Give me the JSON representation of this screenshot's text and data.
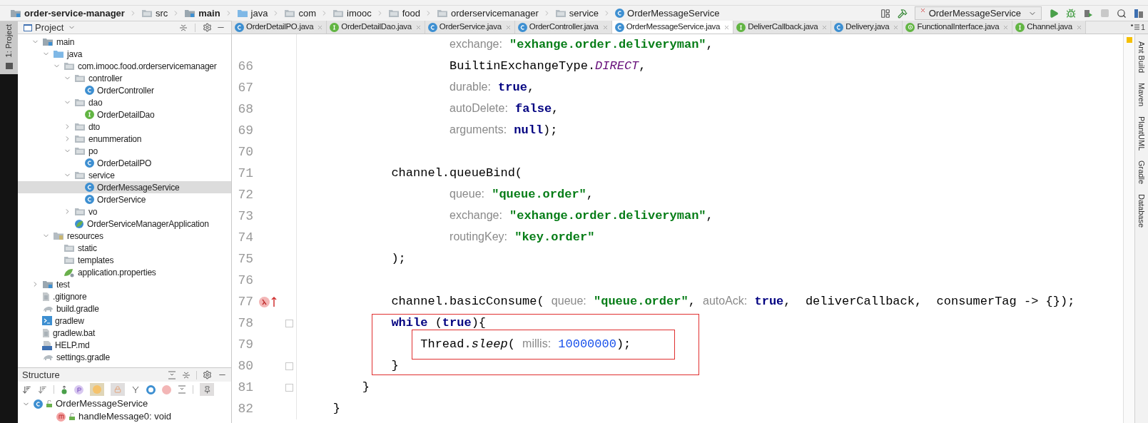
{
  "breadcrumbs": [
    {
      "label": "order-service-manager",
      "kind": "module",
      "bold": true
    },
    {
      "label": "src",
      "kind": "folder",
      "bold": false
    },
    {
      "label": "main",
      "kind": "module",
      "bold": true
    },
    {
      "label": "java",
      "kind": "source",
      "bold": false
    },
    {
      "label": "com",
      "kind": "folder",
      "bold": false
    },
    {
      "label": "imooc",
      "kind": "folder",
      "bold": false
    },
    {
      "label": "food",
      "kind": "folder",
      "bold": false
    },
    {
      "label": "orderservicemanager",
      "kind": "folder",
      "bold": false
    },
    {
      "label": "service",
      "kind": "folder",
      "bold": false
    },
    {
      "label": "OrderMessageService",
      "kind": "class",
      "bold": false
    }
  ],
  "run_config": {
    "label": "OrderMessageService"
  },
  "left_strip": {
    "label": "1: Project"
  },
  "project_panel": {
    "title": "Project",
    "tree": [
      {
        "label": "main",
        "kind": "module",
        "expanded": true,
        "selected": false,
        "children": [
          {
            "label": "java",
            "kind": "source",
            "expanded": true,
            "selected": false,
            "children": [
              {
                "label": "com.imooc.food.orderservicemanager",
                "kind": "folder",
                "expanded": true,
                "selected": false,
                "children": [
                  {
                    "label": "controller",
                    "kind": "folder",
                    "expanded": true,
                    "selected": false,
                    "children": [
                      {
                        "label": "OrderController",
                        "kind": "class",
                        "selected": false
                      }
                    ]
                  },
                  {
                    "label": "dao",
                    "kind": "folder",
                    "expanded": true,
                    "selected": false,
                    "children": [
                      {
                        "label": "OrderDetailDao",
                        "kind": "interface",
                        "selected": false
                      }
                    ]
                  },
                  {
                    "label": "dto",
                    "kind": "folder",
                    "expanded": false,
                    "selected": false
                  },
                  {
                    "label": "enummeration",
                    "kind": "folder",
                    "expanded": false,
                    "selected": false
                  },
                  {
                    "label": "po",
                    "kind": "folder",
                    "expanded": true,
                    "selected": false,
                    "children": [
                      {
                        "label": "OrderDetailPO",
                        "kind": "class",
                        "selected": false
                      }
                    ]
                  },
                  {
                    "label": "service",
                    "kind": "folder",
                    "expanded": true,
                    "selected": false,
                    "children": [
                      {
                        "label": "OrderMessageService",
                        "kind": "class",
                        "selected": true
                      },
                      {
                        "label": "OrderService",
                        "kind": "class",
                        "selected": false
                      }
                    ]
                  },
                  {
                    "label": "vo",
                    "kind": "folder",
                    "expanded": false,
                    "selected": false
                  },
                  {
                    "label": "OrderServiceManagerApplication",
                    "kind": "spring",
                    "selected": false
                  }
                ]
              }
            ]
          },
          {
            "label": "resources",
            "kind": "resources",
            "expanded": true,
            "selected": false,
            "children": [
              {
                "label": "static",
                "kind": "folder",
                "selected": false
              },
              {
                "label": "templates",
                "kind": "folder",
                "selected": false
              },
              {
                "label": "application.properties",
                "kind": "properties",
                "selected": false
              }
            ]
          }
        ]
      },
      {
        "label": "test",
        "kind": "module",
        "expanded": false,
        "selected": false
      },
      {
        "label": ".gitignore",
        "kind": "file",
        "selected": false
      },
      {
        "label": "build.gradle",
        "kind": "gradle",
        "selected": false
      },
      {
        "label": "gradlew",
        "kind": "shell",
        "selected": false
      },
      {
        "label": "gradlew.bat",
        "kind": "file",
        "selected": false
      },
      {
        "label": "HELP.md",
        "kind": "markdown",
        "selected": false
      },
      {
        "label": "settings.gradle",
        "kind": "gradle",
        "selected": false
      }
    ]
  },
  "structure_panel": {
    "title": "Structure",
    "tree": [
      {
        "label": "OrderMessageService",
        "kind": "class",
        "expanded": true,
        "children": [
          {
            "label": "handleMessage0: void",
            "kind": "method"
          }
        ]
      }
    ]
  },
  "tabs": [
    {
      "label": "OrderDetailPO.java",
      "kind": "class",
      "selected": false
    },
    {
      "label": "OrderDetailDao.java",
      "kind": "interface",
      "selected": false
    },
    {
      "label": "OrderService.java",
      "kind": "class",
      "selected": false
    },
    {
      "label": "OrderController.java",
      "kind": "class",
      "selected": false
    },
    {
      "label": "OrderMessageService.java",
      "kind": "class",
      "selected": true
    },
    {
      "label": "DeliverCallback.java",
      "kind": "interface",
      "selected": false
    },
    {
      "label": "Delivery.java",
      "kind": "class",
      "selected": false
    },
    {
      "label": "FunctionalInterface.java",
      "kind": "annotation",
      "selected": false
    },
    {
      "label": "Channel.java",
      "kind": "interface",
      "selected": false
    }
  ],
  "tab_overflow": "1",
  "editor": {
    "lines": [
      {
        "fold": false,
        "tokens": [
          {
            "kind": "hint",
            "text": "                    exchange:"
          },
          {
            "kind": "string",
            "text": " \"exhange.order.deliveryman\""
          },
          {
            "kind": "plain",
            "text": ","
          }
        ]
      },
      {
        "num": "66",
        "fold": false,
        "tokens": [
          {
            "kind": "plain",
            "text": "                    BuiltinExchangeType."
          },
          {
            "kind": "constant",
            "text": "DIRECT"
          },
          {
            "kind": "plain",
            "text": ","
          }
        ]
      },
      {
        "num": "67",
        "fold": false,
        "tokens": [
          {
            "kind": "hint",
            "text": "                    durable:"
          },
          {
            "kind": "keyword",
            "text": " true"
          },
          {
            "kind": "plain",
            "text": ","
          }
        ]
      },
      {
        "num": "68",
        "fold": false,
        "tokens": [
          {
            "kind": "hint",
            "text": "                    autoDelete:"
          },
          {
            "kind": "keyword",
            "text": " false"
          },
          {
            "kind": "plain",
            "text": ","
          }
        ]
      },
      {
        "num": "69",
        "fold": false,
        "tokens": [
          {
            "kind": "hint",
            "text": "                    arguments:"
          },
          {
            "kind": "keyword",
            "text": " null"
          },
          {
            "kind": "plain",
            "text": ");"
          }
        ]
      },
      {
        "num": "70",
        "fold": false
      },
      {
        "num": "71",
        "fold": false,
        "tokens": [
          {
            "kind": "plain",
            "text": "            channel.queueBind("
          }
        ]
      },
      {
        "num": "72",
        "fold": false,
        "tokens": [
          {
            "kind": "hint",
            "text": "                    queue:"
          },
          {
            "kind": "string",
            "text": " \"queue.order\""
          },
          {
            "kind": "plain",
            "text": ","
          }
        ]
      },
      {
        "num": "73",
        "fold": false,
        "tokens": [
          {
            "kind": "hint",
            "text": "                    exchange:"
          },
          {
            "kind": "string",
            "text": " \"exhange.order.deliveryman\""
          },
          {
            "kind": "plain",
            "text": ","
          }
        ]
      },
      {
        "num": "74",
        "fold": false,
        "tokens": [
          {
            "kind": "hint",
            "text": "                    routingKey:"
          },
          {
            "kind": "string",
            "text": " \"key.order\""
          }
        ]
      },
      {
        "num": "75",
        "fold": false,
        "tokens": [
          {
            "kind": "plain",
            "text": "            );"
          }
        ]
      },
      {
        "num": "76",
        "fold": false
      },
      {
        "num": "77",
        "fold": false,
        "kind": "lambda",
        "tokens": [
          {
            "kind": "plain",
            "text": "            channel.basicConsume( "
          },
          {
            "kind": "hint",
            "text": "queue:"
          },
          {
            "kind": "string",
            "text": " \"queue.order\""
          },
          {
            "kind": "plain",
            "text": ", "
          },
          {
            "kind": "hint",
            "text": "autoAck:"
          },
          {
            "kind": "keyword",
            "text": " true"
          },
          {
            "kind": "plain",
            "text": ",  deliverCallback,  consumerTag -> {});"
          }
        ]
      },
      {
        "num": "78",
        "fold": true,
        "tokens": [
          {
            "kind": "keyword",
            "text": "            while"
          },
          {
            "kind": "plain",
            "text": " ("
          },
          {
            "kind": "keyword",
            "text": "true"
          },
          {
            "kind": "plain",
            "text": "){"
          }
        ]
      },
      {
        "num": "79",
        "fold": false,
        "tokens": [
          {
            "kind": "plain",
            "text": "                Thread."
          },
          {
            "kind": "method",
            "text": "sleep"
          },
          {
            "kind": "plain",
            "text": "( "
          },
          {
            "kind": "hint",
            "text": "millis:"
          },
          {
            "kind": "number",
            "text": " 10000000"
          },
          {
            "kind": "plain",
            "text": ");"
          }
        ]
      },
      {
        "num": "80",
        "fold": true,
        "tokens": [
          {
            "kind": "plain",
            "text": "            }"
          }
        ]
      },
      {
        "num": "81",
        "fold": true,
        "tokens": [
          {
            "kind": "plain",
            "text": "        }"
          }
        ]
      },
      {
        "num": "82",
        "fold": false,
        "tokens": [
          {
            "kind": "plain",
            "text": "    }"
          }
        ]
      }
    ]
  },
  "right_strip": [
    "Ant Build",
    "Maven",
    "PlantUML",
    "Gradle",
    "Database"
  ]
}
